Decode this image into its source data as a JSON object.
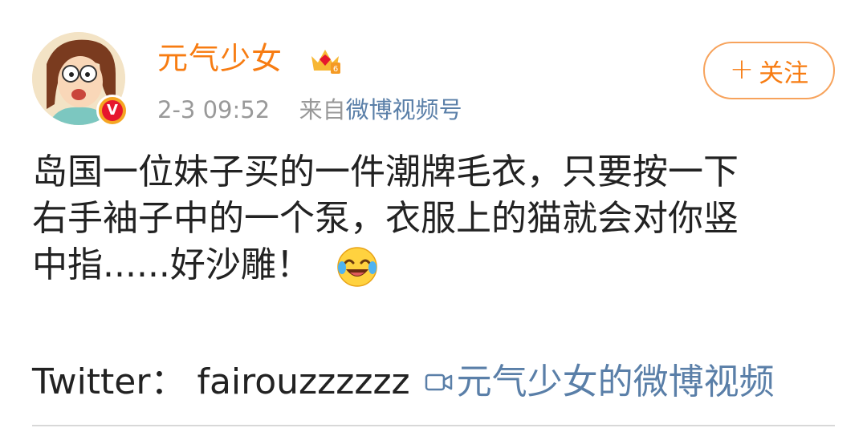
{
  "post": {
    "author": {
      "name": "元气少女",
      "verified_mark": "V",
      "vip_level": "6"
    },
    "follow_label": "关注",
    "follow_plus": "+",
    "time": "2-3 09:52",
    "source_prefix": "来自",
    "source_link": "微博视频号",
    "content_lines": [
      "岛国一位妹子买的一件潮牌毛衣，只要按一下",
      "右手袖子中的一个泵，衣服上的猫就会对你竖",
      "中指......好沙雕！"
    ],
    "twitter_text": "Twitter：  fairouzzzzzz",
    "video_link": "元气少女的微博视频"
  },
  "colors": {
    "username": "#f77c12",
    "link": "#5a7fa8",
    "meta": "#999999",
    "follow_border": "#f7a35c"
  },
  "icons": [
    "avatar-cartoon",
    "verified-badge-icon",
    "vip-crown-icon",
    "laughing-emoji-icon",
    "video-icon"
  ]
}
